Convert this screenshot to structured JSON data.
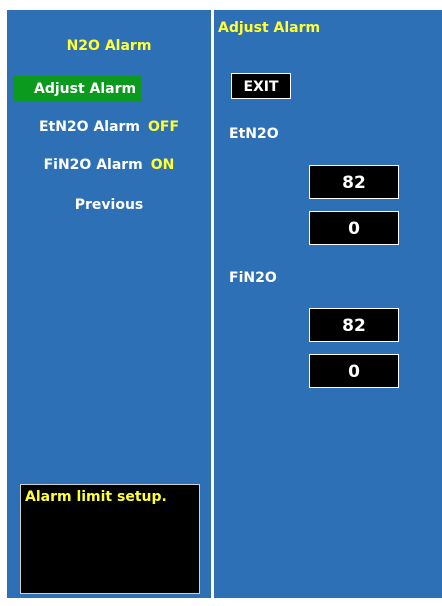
{
  "menu": {
    "title": "N2O Alarm",
    "items": [
      {
        "label": "Adjust Alarm",
        "value": ""
      },
      {
        "label": "EtN2O Alarm",
        "value": "OFF"
      },
      {
        "label": "FiN2O Alarm",
        "value": "ON"
      },
      {
        "label": "Previous",
        "value": ""
      }
    ]
  },
  "help": {
    "text": "Alarm limit setup."
  },
  "adjust": {
    "title": "Adjust Alarm",
    "exit_label": "EXIT",
    "etn2o": {
      "label": "EtN2O",
      "high": "82",
      "low": "0"
    },
    "fin2o": {
      "label": "FiN2O",
      "high": "82",
      "low": "0"
    }
  },
  "colors": {
    "panel": "#2e70b6",
    "highlight": "#0b9a1d",
    "accent_text": "#ffff33"
  }
}
